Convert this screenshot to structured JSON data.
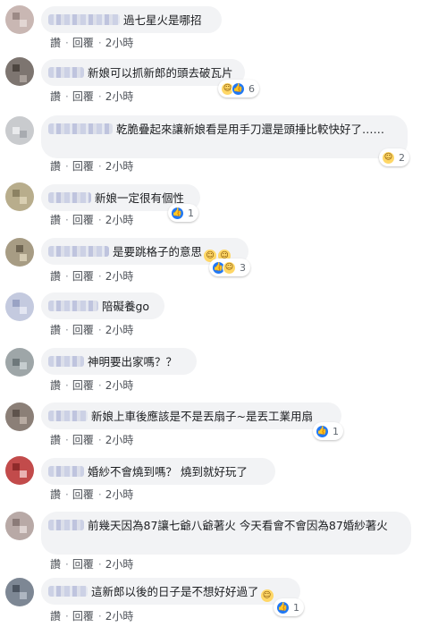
{
  "actions": {
    "like": "讚",
    "reply": "回覆",
    "dot": "·"
  },
  "comments": [
    {
      "text": "過七星火是哪招",
      "time": "2小時",
      "reaction_count": ""
    },
    {
      "text": "新娘可以抓新郎的頭去破瓦片",
      "time": "2小時",
      "reaction_count": "6"
    },
    {
      "text": "乾脆疊起來讓新娘看是用手刀還是頭捶比較快好了……",
      "time": "2小時",
      "reaction_count": "2"
    },
    {
      "text": "新娘一定很有個性",
      "time": "2小時",
      "reaction_count": "1"
    },
    {
      "text": "是要跳格子的意思",
      "time": "2小時",
      "reaction_count": "3"
    },
    {
      "text": "陪礙養go",
      "time": "2小時",
      "reaction_count": ""
    },
    {
      "text": "神明要出家嗎？？",
      "time": "2小時",
      "reaction_count": ""
    },
    {
      "text": "新娘上車後應該是不是丟扇子~是丟工業用扇",
      "time": "2小時",
      "reaction_count": "1"
    },
    {
      "text": "婚紗不會燒到嗎？ 燒到就好玩了",
      "time": "2小時",
      "reaction_count": ""
    },
    {
      "text": "前幾天因為87讓七爺八爺著火 今天看會不會因為87婚紗著火",
      "time": "2小時",
      "reaction_count": ""
    },
    {
      "text": "這新郎以後的日子是不想好好過了",
      "time": "2小時",
      "reaction_count": "1"
    }
  ],
  "colors": {
    "like": "#2078f4",
    "haha": "#ffd766",
    "bubble": "#f2f3f5",
    "action_text": "#4b4f56"
  }
}
